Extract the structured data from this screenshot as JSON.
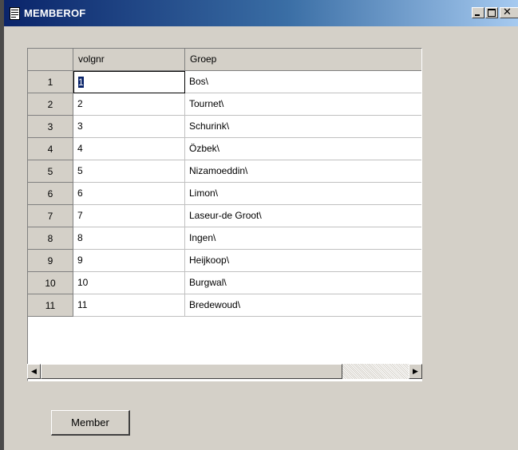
{
  "window": {
    "title": "MEMBEROF"
  },
  "grid": {
    "columns": [
      "volgnr",
      "Groep"
    ],
    "active_cell": {
      "row": 0,
      "column": "volgnr"
    },
    "rows": [
      {
        "rownum": "1",
        "volgnr": "1",
        "groep": "Bos\\"
      },
      {
        "rownum": "2",
        "volgnr": "2",
        "groep": "Tournet\\"
      },
      {
        "rownum": "3",
        "volgnr": "3",
        "groep": "Schurink\\"
      },
      {
        "rownum": "4",
        "volgnr": "4",
        "groep": "Özbek\\"
      },
      {
        "rownum": "5",
        "volgnr": "5",
        "groep": "Nizamoeddin\\"
      },
      {
        "rownum": "6",
        "volgnr": "6",
        "groep": "Limon\\"
      },
      {
        "rownum": "7",
        "volgnr": "7",
        "groep": "Laseur-de Groot\\"
      },
      {
        "rownum": "8",
        "volgnr": "8",
        "groep": "Ingen\\"
      },
      {
        "rownum": "9",
        "volgnr": "9",
        "groep": "Heijkoop\\"
      },
      {
        "rownum": "10",
        "volgnr": "10",
        "groep": "Burgwal\\"
      },
      {
        "rownum": "11",
        "volgnr": "11",
        "groep": "Bredewoud\\"
      }
    ]
  },
  "icons": {
    "window": "document-icon",
    "minimize": "minimize-icon",
    "maximize": "maximize-icon",
    "close": "close-icon",
    "scroll_left": "arrow-left-icon",
    "scroll_right": "arrow-right-icon"
  },
  "buttons": {
    "member": "Member"
  }
}
